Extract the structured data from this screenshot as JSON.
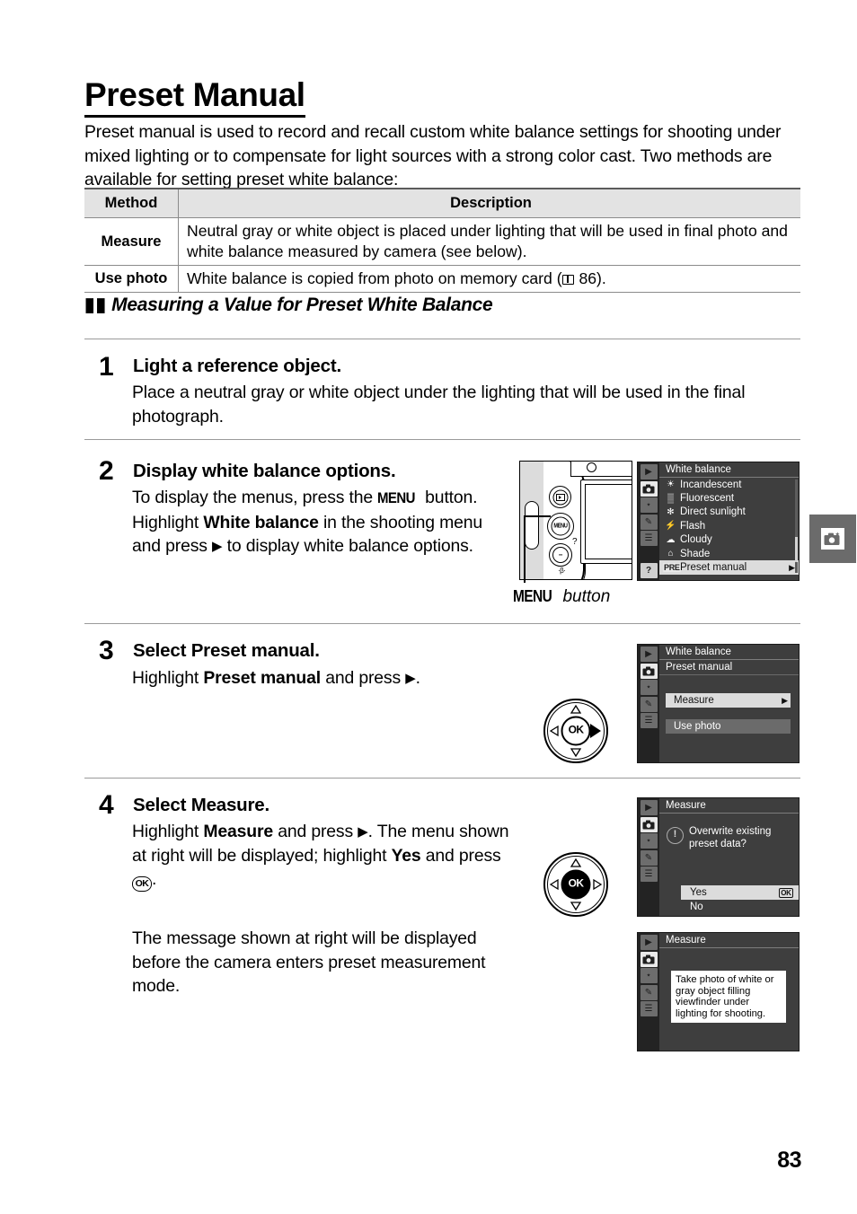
{
  "page": {
    "title": "Preset Manual",
    "number": "83",
    "intro": "Preset manual is used to record and recall custom white balance settings for shooting under mixed lighting or to compensate for light sources with a strong color cast.  Two methods are available for setting preset white balance:"
  },
  "table": {
    "headers": [
      "Method",
      "Description"
    ],
    "rows": [
      {
        "method": "Measure",
        "description": "Neutral gray or white object is placed under lighting that will be used in final photo and white balance measured by camera (see below)."
      },
      {
        "method": "Use photo",
        "description_pre": "White balance is copied from photo on memory card (",
        "description_ref": "86",
        "description_post": ")."
      }
    ]
  },
  "subheading": {
    "marks": "▮▮",
    "text": "Measuring a Value for Preset White Balance"
  },
  "steps": [
    {
      "number": "1",
      "heading": "Light a reference object.",
      "body": "Place a neutral gray or white object under the lighting that will be used in the final photograph."
    },
    {
      "number": "2",
      "heading": "Display white balance options.",
      "body_1": "To display the menus, press the ",
      "body_menu_key": "MENU",
      "body_2": " button. Highlight ",
      "body_bold": "White balance",
      "body_3": " in the shooting menu and press ",
      "body_arrow": "▶",
      "body_4": " to display white balance options.",
      "caption_key": "MENU",
      "caption_word": "button"
    },
    {
      "number": "3",
      "heading_pre": "Select ",
      "heading_bold": "Preset manual",
      "heading_post": ".",
      "body_1": "Highlight ",
      "body_bold": "Preset manual",
      "body_2": " and press ",
      "body_arrow": "▶",
      "body_3": "."
    },
    {
      "number": "4",
      "heading_pre": "Select ",
      "heading_bold": "Measure",
      "heading_post": ".",
      "body_1": "Highlight ",
      "body_bold1": "Measure",
      "body_2": " and press ",
      "body_arrow": "▶",
      "body_3": ".  The menu shown at right will be displayed; highlight ",
      "body_bold2": "Yes",
      "body_4": " and press ",
      "body_ok": "OK",
      "body_5": ".",
      "body_second": "The message shown at right will be displayed before the camera enters preset measurement mode."
    }
  ],
  "screens": {
    "white_balance": {
      "title": "White balance",
      "items": [
        {
          "icon": "incandescent-icon",
          "glyph": "☀",
          "label": "Incandescent",
          "selected": false
        },
        {
          "icon": "fluorescent-icon",
          "glyph": "▒",
          "label": "Fluorescent",
          "selected": false
        },
        {
          "icon": "direct-sunlight-icon",
          "glyph": "✻",
          "label": "Direct sunlight",
          "selected": false
        },
        {
          "icon": "flash-icon",
          "glyph": "⚡",
          "label": "Flash",
          "selected": false
        },
        {
          "icon": "cloudy-icon",
          "glyph": "☁",
          "label": "Cloudy",
          "selected": false
        },
        {
          "icon": "shade-icon",
          "glyph": "⌂",
          "label": "Shade",
          "selected": false
        },
        {
          "icon": "preset-manual-icon",
          "glyph": "PRE",
          "label": "Preset manual",
          "selected": true,
          "arrow": "▶"
        }
      ]
    },
    "preset_manual": {
      "title": "White balance",
      "subtitle": "Preset manual",
      "options": [
        {
          "label": "Measure",
          "selected": true,
          "arrow": "▶"
        },
        {
          "label": "Use photo",
          "selected": false
        }
      ]
    },
    "overwrite_dialog": {
      "title": "Measure",
      "warn_glyph": "!",
      "message": "Overwrite existing preset data?",
      "choices": [
        {
          "label": "Yes",
          "selected": true,
          "badge": "OK"
        },
        {
          "label": "No",
          "selected": false
        }
      ]
    },
    "measure_message": {
      "title": "Measure",
      "message": "Take photo of white or gray object filling viewfinder under lighting for shooting."
    },
    "sidebar_icons": [
      {
        "name": "playback-icon",
        "glyph": "▶"
      },
      {
        "name": "shooting-menu-camera-icon",
        "glyph": "◉",
        "active": true
      },
      {
        "name": "setup-wrench-icon",
        "glyph": "⑂"
      },
      {
        "name": "retouch-icon",
        "glyph": "✎"
      },
      {
        "name": "recent-settings-icon",
        "glyph": "☰"
      },
      {
        "name": "help-question-icon",
        "glyph": "?"
      }
    ]
  },
  "margin_tab": {
    "icon": "camera-star-icon"
  }
}
